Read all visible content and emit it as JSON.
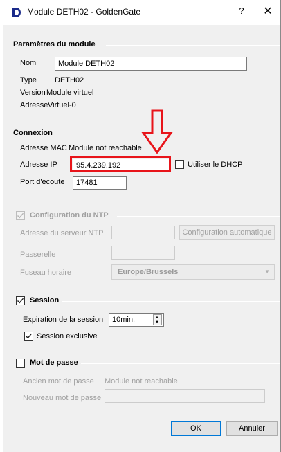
{
  "window": {
    "title": "Module DETH02 - GoldenGate",
    "help": "?",
    "close": "✕"
  },
  "module": {
    "section_title": "Paramètres du module",
    "nom_label": "Nom",
    "nom_value": "Module DETH02",
    "type_label": "Type",
    "type_value": "DETH02",
    "version_label": "Version",
    "version_value": "Module virtuel",
    "adresse_label": "Adresse",
    "adresse_value": "Virtuel-0"
  },
  "connexion": {
    "section_title": "Connexion",
    "mac_label": "Adresse MAC",
    "mac_value": "Module not reachable",
    "ip_label": "Adresse IP",
    "ip_value": "95.4.239.192",
    "dhcp_label": "Utiliser le DHCP",
    "dhcp_checked": false,
    "port_label": "Port d'écoute",
    "port_value": "17481"
  },
  "ntp": {
    "section_title": "Configuration du NTP",
    "checked": true,
    "server_label": "Adresse du serveur NTP",
    "server_value": "",
    "auto_button": "Configuration automatique",
    "gateway_label": "Passerelle",
    "gateway_value": "",
    "timezone_label": "Fuseau horaire",
    "timezone_value": "Europe/Brussels"
  },
  "session": {
    "section_title": "Session",
    "checked": true,
    "expiration_label": "Expiration de la session",
    "expiration_value": "10min.",
    "exclusive_label": "Session exclusive",
    "exclusive_checked": true
  },
  "password": {
    "section_title": "Mot de passe",
    "checked": false,
    "old_label": "Ancien mot de passe",
    "old_value": "Module not reachable",
    "new_label": "Nouveau mot de passe",
    "new_value": ""
  },
  "buttons": {
    "ok": "OK",
    "cancel": "Annuler"
  },
  "colors": {
    "highlight": "#e8141a",
    "accent": "#0078d7",
    "app_icon": "#1a2a8a"
  }
}
